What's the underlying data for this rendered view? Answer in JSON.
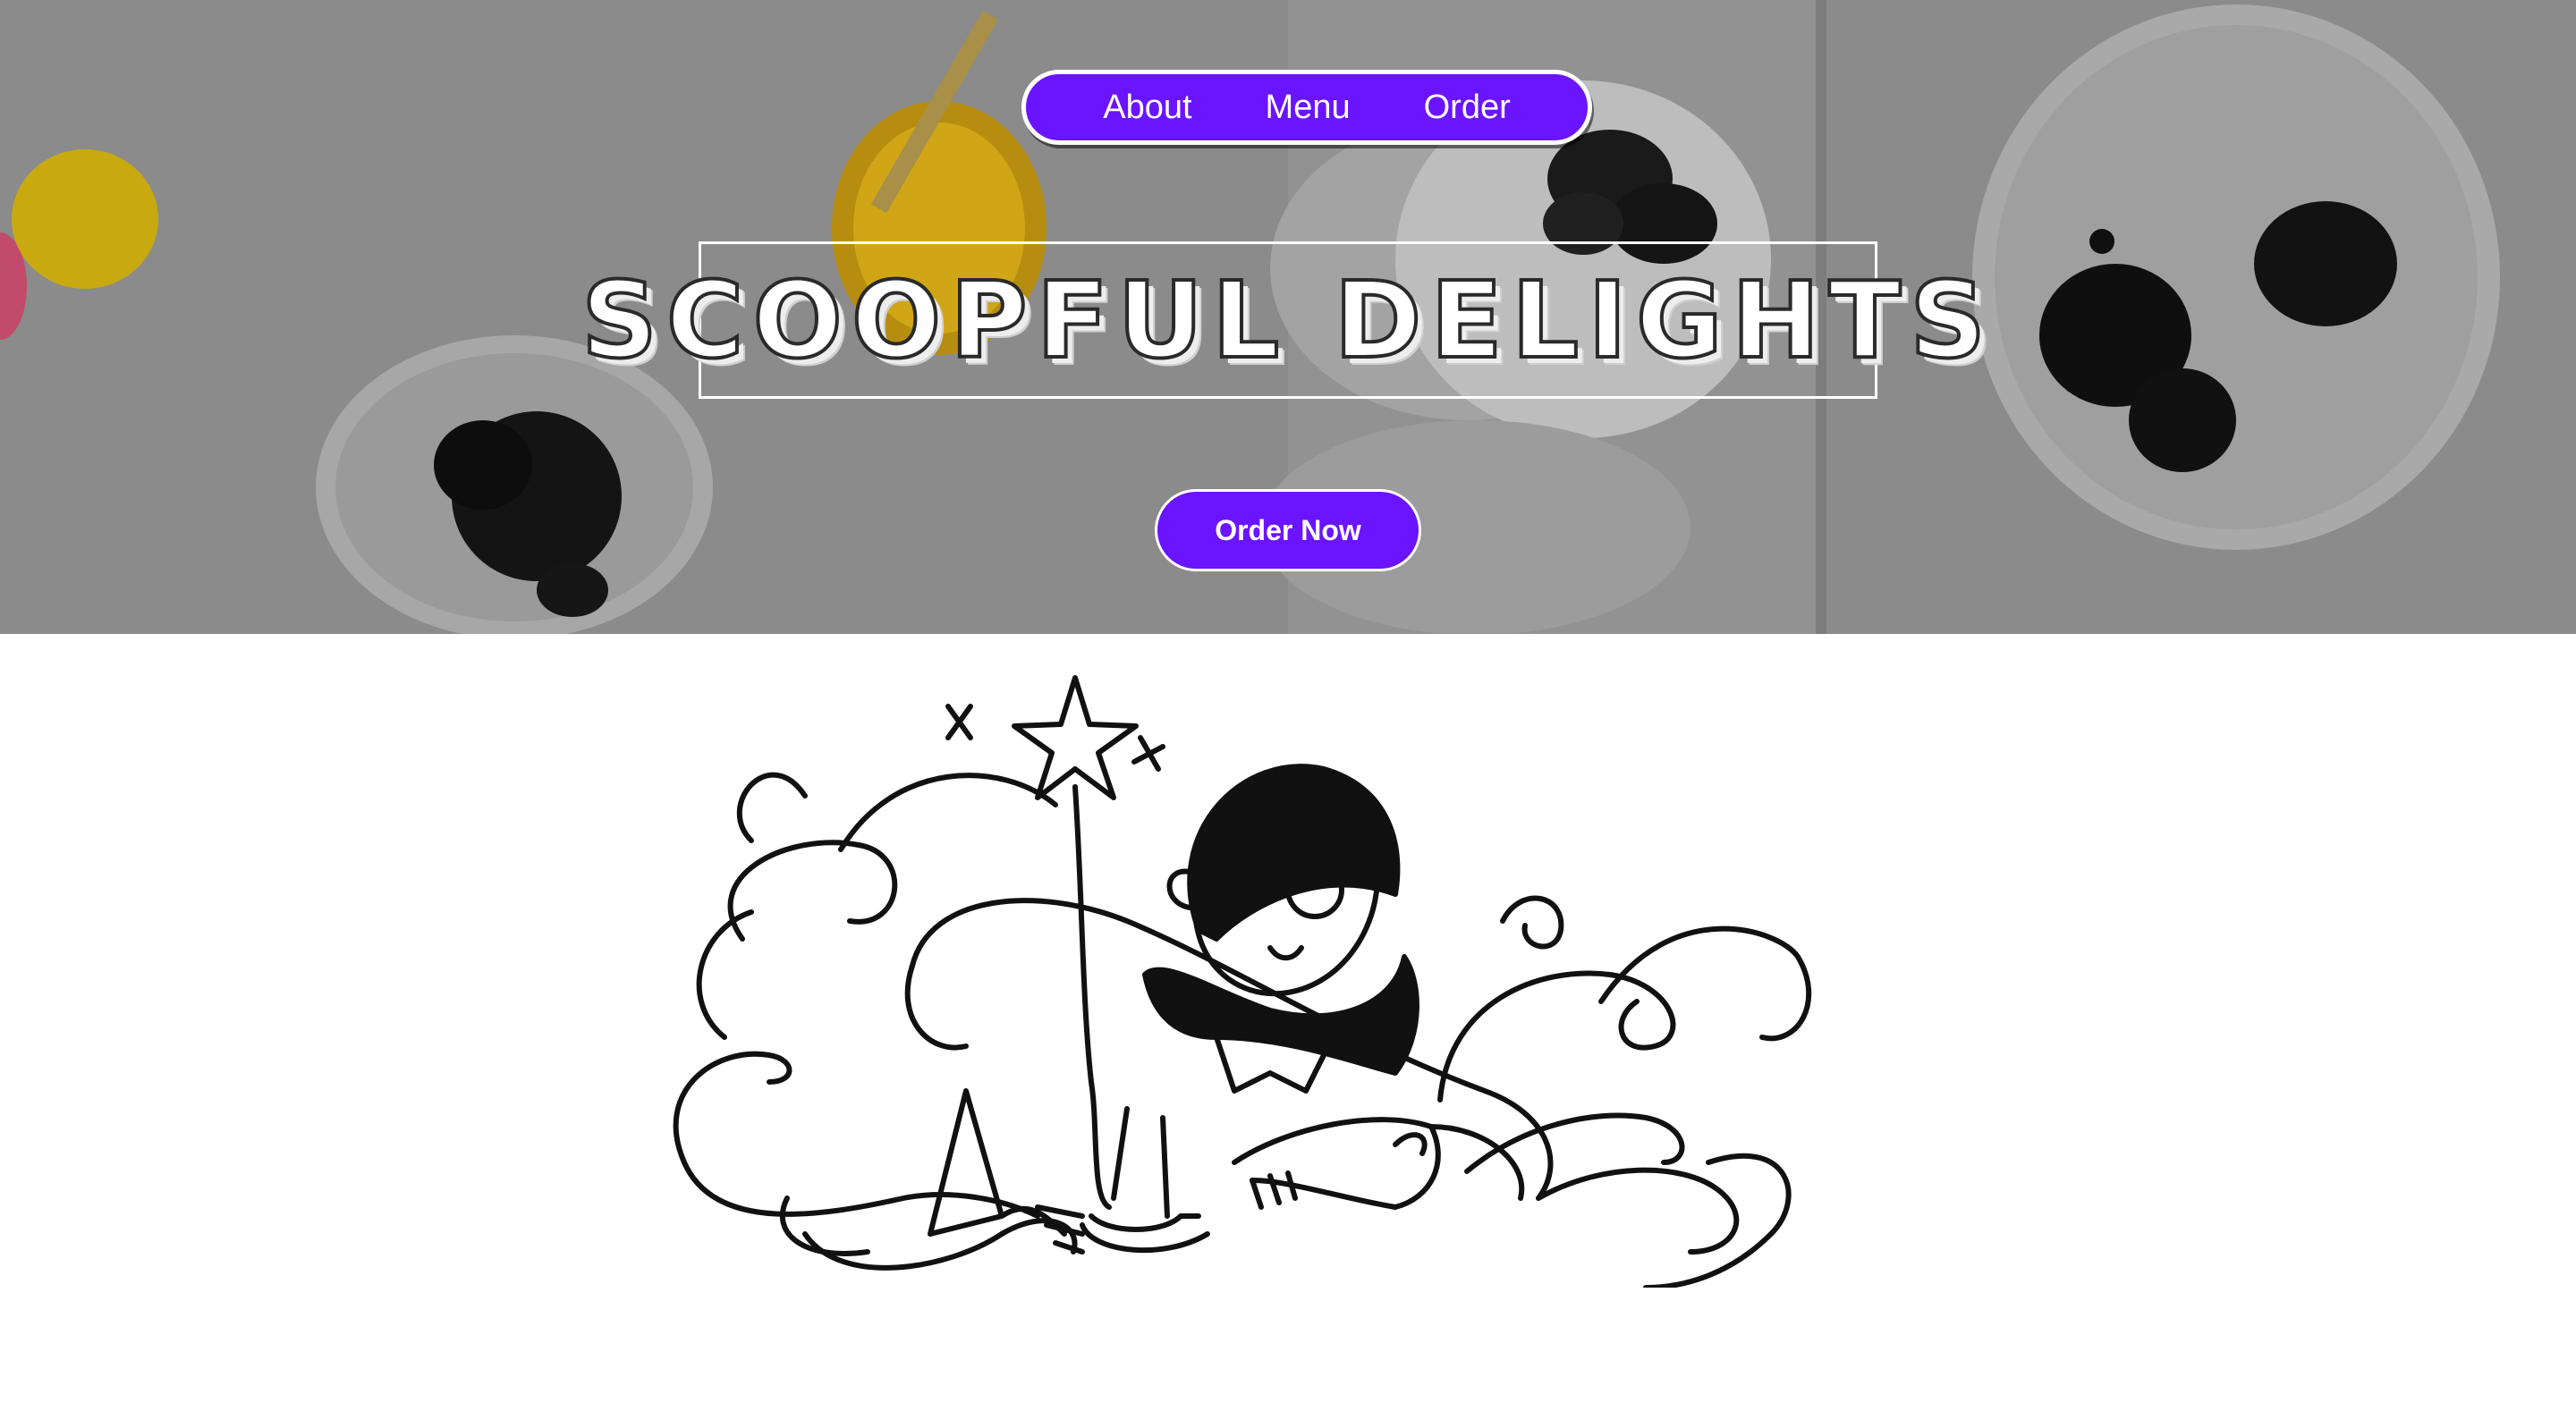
{
  "nav": {
    "items": [
      {
        "label": "About"
      },
      {
        "label": "Menu"
      },
      {
        "label": "Order"
      }
    ]
  },
  "hero": {
    "title": "SCOOPFUL DELIGHTS",
    "cta_label": "Order Now"
  },
  "colors": {
    "accent": "#6a14ff",
    "hero_overlay": "#7f7f7f",
    "text_on_accent": "#ffffff"
  },
  "icons": {
    "hero_background": "ice-cream-table-photo",
    "illustration": "person-with-magic-wand-drawing"
  }
}
